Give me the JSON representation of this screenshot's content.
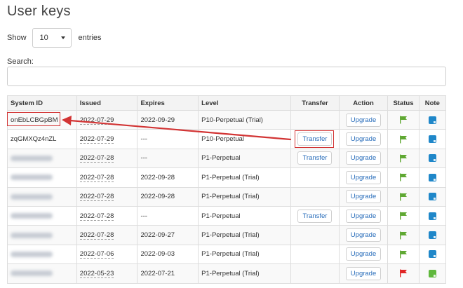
{
  "page": {
    "title": "User keys"
  },
  "length": {
    "show_label": "Show",
    "value": "10",
    "entries_label": "entries"
  },
  "search": {
    "label": "Search:",
    "value": "",
    "placeholder": ""
  },
  "table": {
    "headers": {
      "system_id": "System ID",
      "issued": "Issued",
      "expires": "Expires",
      "level": "Level",
      "transfer": "Transfer",
      "action": "Action",
      "status": "Status",
      "note": "Note"
    },
    "rows": [
      {
        "system_id": "onEbLCBGpBM",
        "issued": "2022-07-29",
        "expires": "2022-09-29",
        "level": "P10-Perpetual (Trial)",
        "transfer": "",
        "action": "Upgrade",
        "status": "green",
        "note": "blue"
      },
      {
        "system_id": "zqGMXQz4nZL",
        "issued": "2022-07-29",
        "expires": "---",
        "level": "P10-Perpetual",
        "transfer": "Transfer",
        "action": "Upgrade",
        "status": "green",
        "note": "blue"
      },
      {
        "system_id": "",
        "issued": "2022-07-28",
        "expires": "---",
        "level": "P1-Perpetual",
        "transfer": "Transfer",
        "action": "Upgrade",
        "status": "green",
        "note": "blue"
      },
      {
        "system_id": "",
        "issued": "2022-07-28",
        "expires": "2022-09-28",
        "level": "P1-Perpetual (Trial)",
        "transfer": "",
        "action": "Upgrade",
        "status": "green",
        "note": "blue"
      },
      {
        "system_id": "",
        "issued": "2022-07-28",
        "expires": "2022-09-28",
        "level": "P1-Perpetual (Trial)",
        "transfer": "",
        "action": "Upgrade",
        "status": "green",
        "note": "blue"
      },
      {
        "system_id": "",
        "issued": "2022-07-28",
        "expires": "---",
        "level": "P1-Perpetual",
        "transfer": "Transfer",
        "action": "Upgrade",
        "status": "green",
        "note": "blue"
      },
      {
        "system_id": "",
        "issued": "2022-07-28",
        "expires": "2022-09-27",
        "level": "P1-Perpetual (Trial)",
        "transfer": "",
        "action": "Upgrade",
        "status": "green",
        "note": "blue"
      },
      {
        "system_id": "",
        "issued": "2022-07-06",
        "expires": "2022-09-03",
        "level": "P1-Perpetual (Trial)",
        "transfer": "",
        "action": "Upgrade",
        "status": "green",
        "note": "blue"
      },
      {
        "system_id": "",
        "issued": "2022-05-23",
        "expires": "2022-07-21",
        "level": "P1-Perpetual (Trial)",
        "transfer": "",
        "action": "Upgrade",
        "status": "red",
        "note": "green"
      }
    ]
  },
  "colors": {
    "link": "#2a6ebb",
    "flag_green": "#5fa832",
    "flag_red": "#e02424",
    "note_blue": "#1f87c9",
    "note_green": "#5fb83c",
    "annotation": "#d23434"
  },
  "icons": {
    "status": "flag-icon",
    "note": "note-icon"
  }
}
